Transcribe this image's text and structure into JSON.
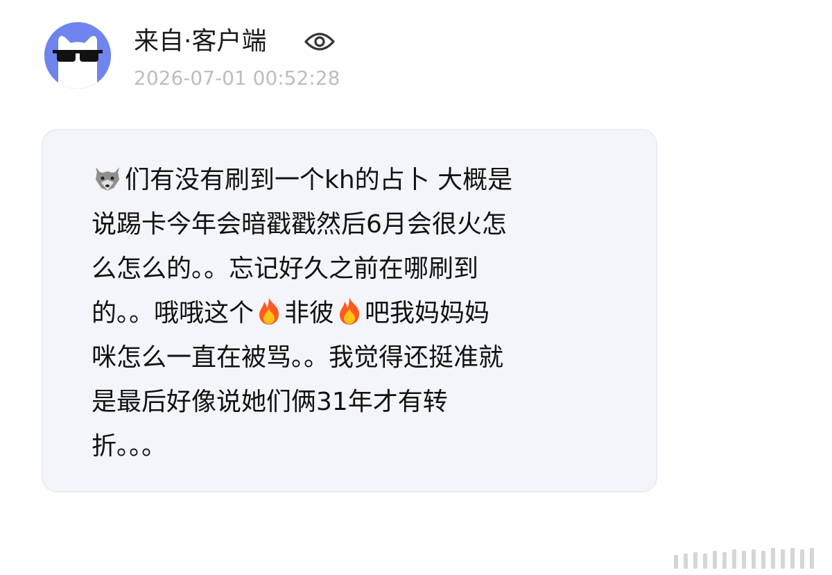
{
  "post": {
    "author": "来自·客户端",
    "timestamp": "2026-07-01 00:52:28",
    "avatar_icon": "sunglasses-cat-avatar",
    "visibility_icon": "eye-icon"
  },
  "message": {
    "lines": [
      "们有没有刷到一个kh的占卜 大概是",
      "说踢卡今年会暗戳戳然后6月会很火怎",
      "么怎么的。。忘记好久之前在哪刷到",
      [
        "的。。哦哦这个",
        "非彼",
        "吧我妈妈妈"
      ],
      "咪怎么一直在被骂。。我觉得还挺准就",
      "是最后好像说她们俩31年才有转",
      "折。。。"
    ],
    "emojis": [
      "wolf-emoji",
      "fire-emoji",
      "fire-emoji"
    ]
  },
  "colors": {
    "avatar_bg": "#6f84ee",
    "bubble_bg": "#f3f5fb",
    "timestamp": "#bdbdbd"
  }
}
